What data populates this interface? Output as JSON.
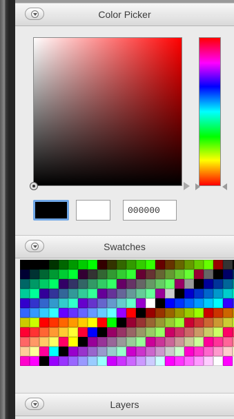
{
  "color_picker": {
    "title": "Color Picker",
    "hex_value": "000000",
    "current_color": "#000000",
    "previous_color": "#ffffff",
    "hue_color": "#ff0000"
  },
  "swatches": {
    "title": "Swatches",
    "gray_column": [
      "#000000",
      "#333333",
      "#666666",
      "#999999",
      "#cccccc",
      "#ffffff",
      "#ff0000",
      "#00ff00",
      "#0000ff",
      "#ffff00",
      "#00ffff",
      "#ff00ff"
    ]
  },
  "layers": {
    "title": "Layers"
  },
  "icons": {
    "collapse": "chevron-down-icon"
  },
  "colors": {
    "panel_bg": "#eaeaea",
    "selection_blue": "#6fa6e6"
  }
}
